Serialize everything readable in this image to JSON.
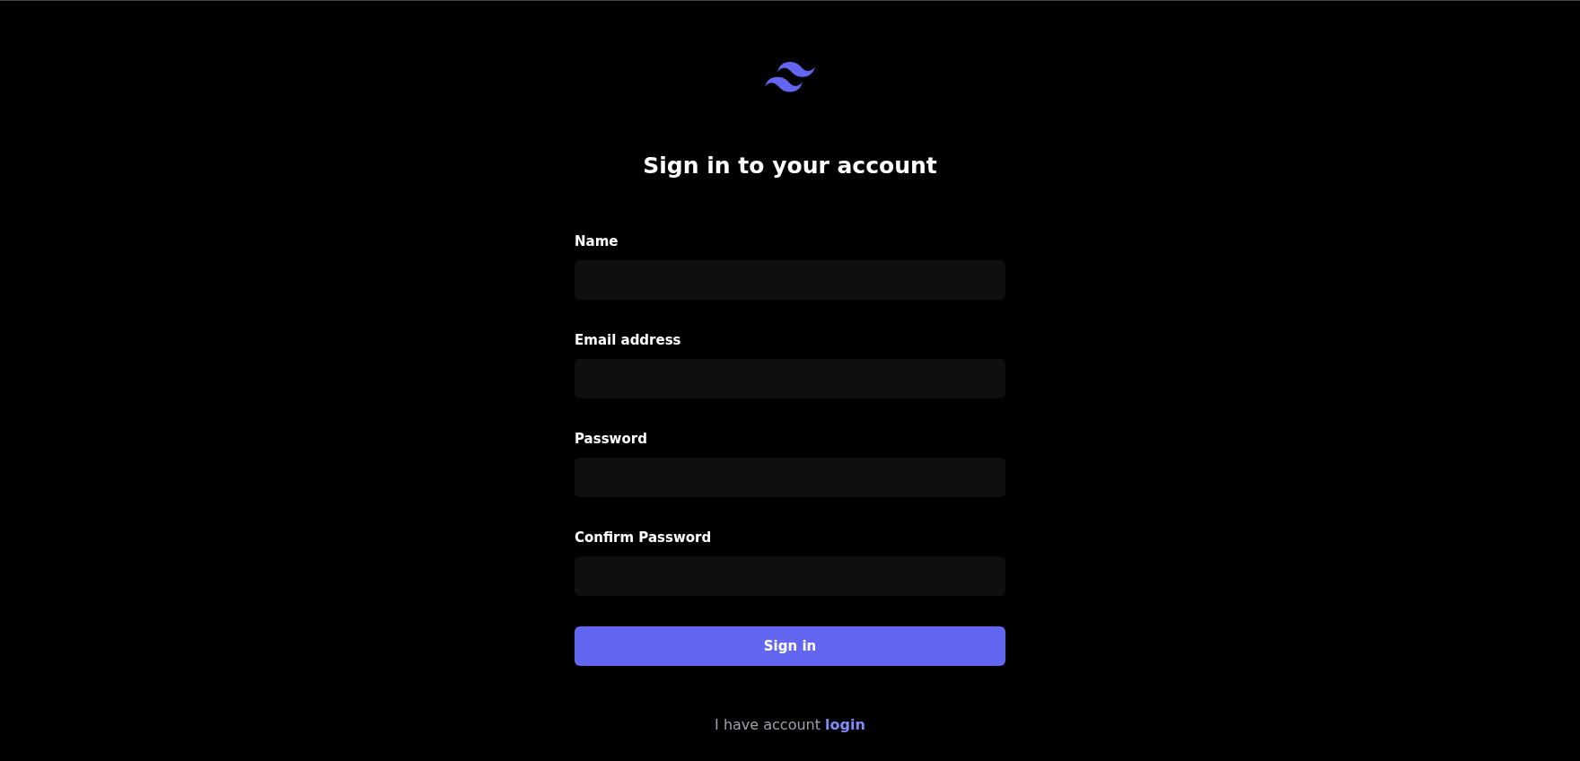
{
  "title": "Sign in to your account",
  "fields": [
    {
      "label": "Name"
    },
    {
      "label": "Email address"
    },
    {
      "label": "Password"
    },
    {
      "label": "Confirm Password"
    }
  ],
  "submit": "Sign in",
  "footer": {
    "text": "I have account",
    "link": "login"
  }
}
